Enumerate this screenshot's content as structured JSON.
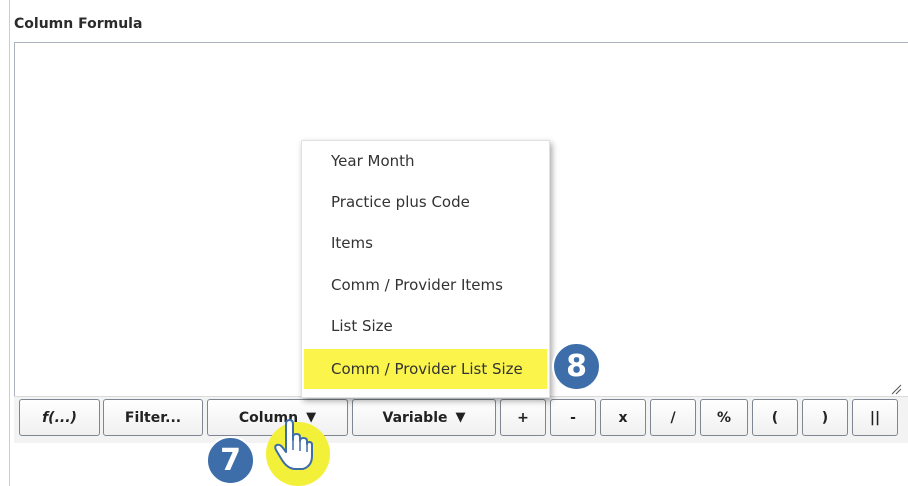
{
  "panel": {
    "title": "Column Formula"
  },
  "menu": {
    "items": [
      {
        "label": "Year Month",
        "highlighted": false
      },
      {
        "label": "Practice plus Code",
        "highlighted": false
      },
      {
        "label": "Items",
        "highlighted": false
      },
      {
        "label": "Comm / Provider Items",
        "highlighted": false
      },
      {
        "label": "List Size",
        "highlighted": false
      },
      {
        "label": "Comm / Provider List Size",
        "highlighted": true
      }
    ],
    "highlight_color": "#faf44b"
  },
  "toolbar": {
    "function_label": "f(...)",
    "filter_label": "Filter...",
    "column_label": "Column",
    "variable_label": "Variable",
    "dropdown_caret": "▼",
    "ops": [
      "+",
      "-",
      "x",
      "/",
      "%",
      "(",
      ")",
      "||"
    ]
  },
  "callouts": {
    "step_column": "7",
    "step_menu_item": "8",
    "color": "#3d6ea9"
  },
  "icons": {
    "cursor": "hand-pointer-icon",
    "resize": "resize-grip-icon"
  }
}
